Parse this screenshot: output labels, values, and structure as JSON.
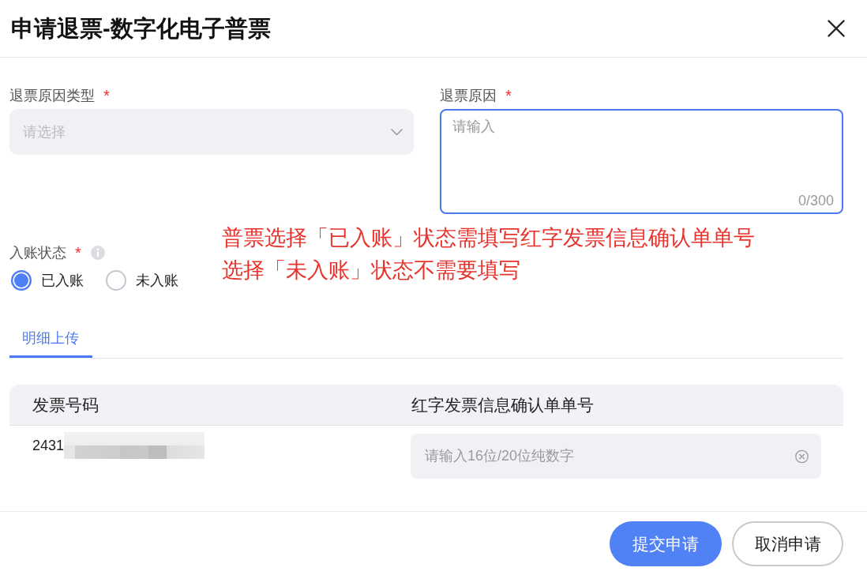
{
  "window": {
    "title": "申请退票-数字化电子普票"
  },
  "fields": [
    {
      "kind": "select",
      "label": "退票原因类型",
      "required_mark": "*",
      "placeholder": "请选择",
      "focused": false
    },
    {
      "kind": "textarea",
      "label": "退票原因",
      "required_mark": "*",
      "placeholder": "请输入",
      "counter": "0/300",
      "focused": true
    }
  ],
  "entry_status": {
    "label": "入账状态",
    "required_mark": "*",
    "options": [
      {
        "label": "已入账",
        "selected": true
      },
      {
        "label": "未入账",
        "selected": false
      }
    ]
  },
  "annotation": {
    "lines": [
      "普票选择「已入账」状态需填写红字发票信息确认单单号",
      "选择「未入账」状态不需要填写"
    ]
  },
  "tabs": [
    {
      "label": "明细上传",
      "selected": true
    }
  ],
  "table": {
    "columns": [
      "发票号码",
      "红字发票信息确认单单号"
    ],
    "rows": [
      {
        "invoice_number": "2431",
        "confirmation_input": {
          "placeholder": "请输入16位/20位纯数字"
        }
      }
    ]
  },
  "buttons": [
    {
      "label": "提交申请",
      "kind": "primary"
    },
    {
      "label": "取消申请",
      "kind": "secondary"
    }
  ]
}
